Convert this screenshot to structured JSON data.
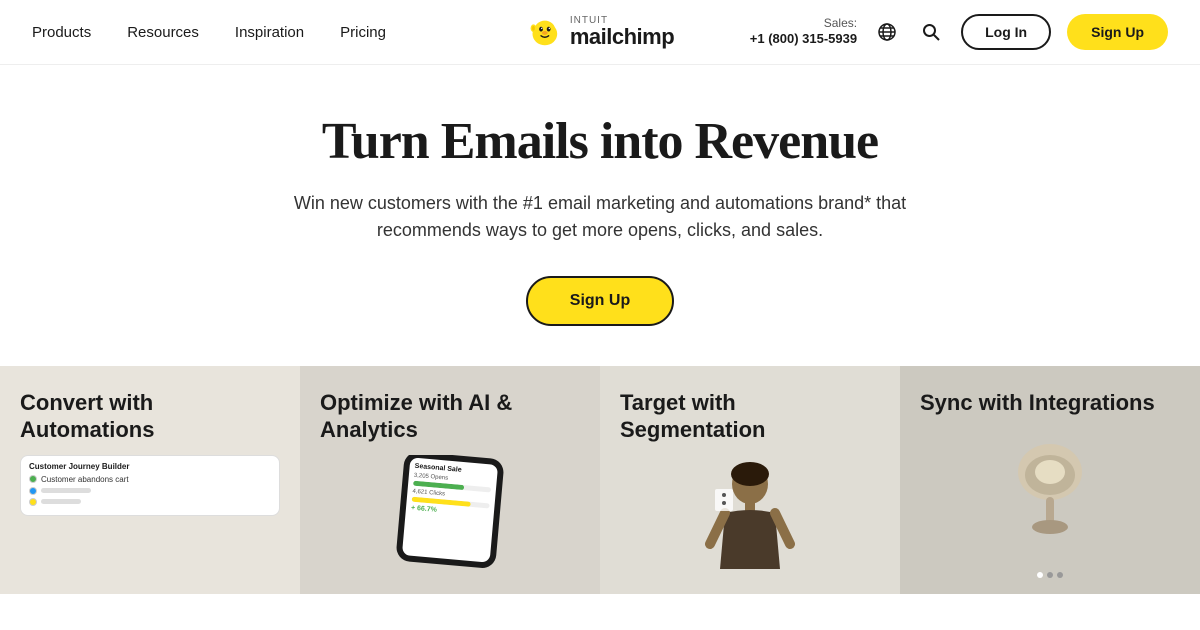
{
  "nav": {
    "items": [
      {
        "label": "Products",
        "id": "products"
      },
      {
        "label": "Resources",
        "id": "resources"
      },
      {
        "label": "Inspiration",
        "id": "inspiration"
      },
      {
        "label": "Pricing",
        "id": "pricing"
      }
    ],
    "logo": {
      "intuit_label": "intuit",
      "mailchimp_label": "mailchimp"
    },
    "sales_label": "Sales:",
    "sales_phone": "+1 (800) 315-5939",
    "login_label": "Log In",
    "signup_label": "Sign Up"
  },
  "hero": {
    "title": "Turn Emails into Revenue",
    "subtitle": "Win new customers with the #1 email marketing and automations brand* that recommends ways to get more opens, clicks, and sales.",
    "cta_label": "Sign Up"
  },
  "features": [
    {
      "title": "Convert with Automations",
      "mock": {
        "header": "Customer Journey Builder",
        "step1": "Customer abandons cart",
        "step2": "",
        "step3": ""
      }
    },
    {
      "title": "Optimize with AI & Analytics",
      "mock": {
        "header": "Seasonal Sale",
        "stat1": "3,205 Opens",
        "stat2": "4,621 Clicks",
        "stat3": "+ 66.7%"
      }
    },
    {
      "title": "Target with Segmentation",
      "mock": {}
    },
    {
      "title": "Sync with Integrations",
      "mock": {}
    }
  ]
}
